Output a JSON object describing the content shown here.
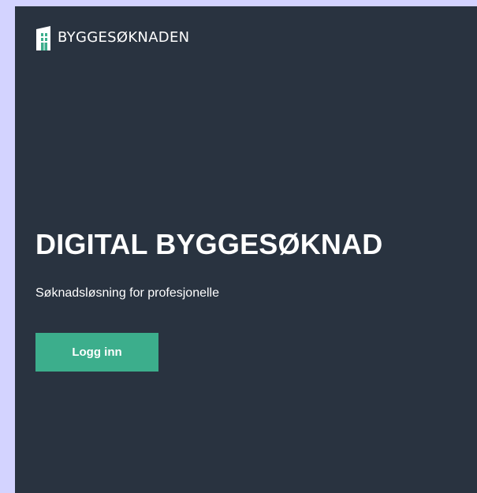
{
  "brand": {
    "name": "BYGGESØKNADEN",
    "icon": "building-icon"
  },
  "hero": {
    "title": "DIGITAL BYGGESØKNAD",
    "subtitle": "Søknadsløsning for profesjonelle"
  },
  "actions": {
    "login_label": "Logg inn"
  },
  "colors": {
    "background": "#293340",
    "accent": "#3cae8c",
    "outer": "#d3d3ff",
    "text": "#ffffff"
  }
}
